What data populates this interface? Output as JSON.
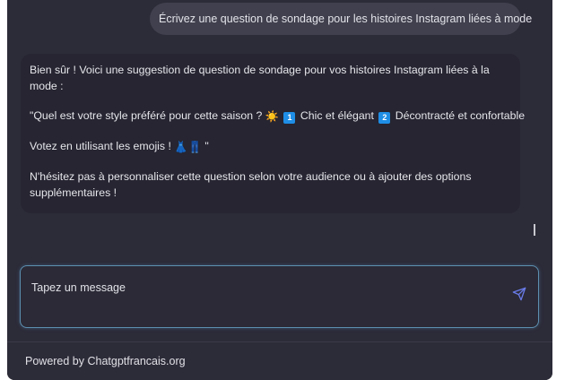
{
  "user_message": "Écrivez une question de sondage pour les histoires Instagram liées à mode",
  "assistant": {
    "intro": "Bien sûr ! Voici une suggestion de question de sondage pour vos histoires Instagram liées à la mode :",
    "question_start": "\"Quel est votre style préféré pour cette saison ?",
    "question_sun_emoji": "☀️",
    "option1_key": "1",
    "option1_text": "Chic et élégant",
    "option2_key": "2",
    "option2_text": "Décontracté et confortable",
    "vote_text": "Votez en utilisant les emojis !",
    "vote_emoji_dress": "👗",
    "vote_emoji_jeans": "👖",
    "vote_end": "\"",
    "closing": "N'hésitez pas à personnaliser cette question selon votre audience ou à ajouter des options supplémentaires !"
  },
  "composer": {
    "placeholder": "Tapez un message",
    "send_icon": "send-icon"
  },
  "footer": {
    "text": "Powered by Chatgptfrancais.org"
  },
  "colors": {
    "panel_bg": "#2c2b38",
    "user_bubble_bg": "#40404e",
    "assistant_bubble_bg": "#262531",
    "composer_border": "#5d8fb0",
    "send_icon": "#6a7be8"
  }
}
